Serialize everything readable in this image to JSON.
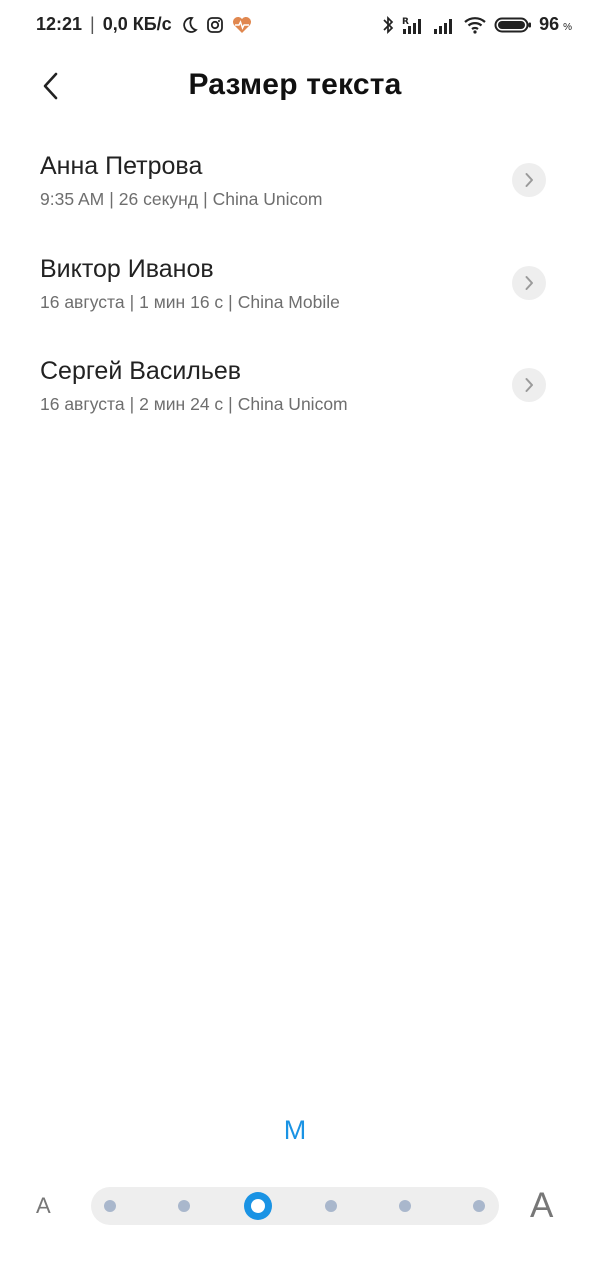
{
  "status_bar": {
    "time": "12:21",
    "separator": "|",
    "network_speed": "0,0 КБ/с",
    "battery_level": "96",
    "battery_unit": "%",
    "icons": [
      "moon-icon",
      "instagram-icon",
      "health-icon",
      "bluetooth-icon",
      "signal-roaming-icon",
      "signal-icon",
      "wifi-icon",
      "battery-icon"
    ],
    "health_icon_color": "#e0874f"
  },
  "header": {
    "title": "Размер текста",
    "back_icon": "chevron-left-icon"
  },
  "calls": [
    {
      "name": "Анна Петрова",
      "time": "9:35 AM",
      "duration": "26 секунд",
      "carrier": "China Unicom"
    },
    {
      "name": "Виктор Иванов",
      "time": "16 августа",
      "duration": "1 мин 16 с",
      "carrier": "China Mobile"
    },
    {
      "name": "Сергей Васильев",
      "time": "16 августа",
      "duration": "2 мин 24 с",
      "carrier": "China Unicom"
    }
  ],
  "meta_separator": "|",
  "text_size": {
    "current_label": "M",
    "small_label": "A",
    "large_label": "A",
    "levels": 6,
    "selected_level_index": 2,
    "accent_color": "#1a93e4"
  }
}
